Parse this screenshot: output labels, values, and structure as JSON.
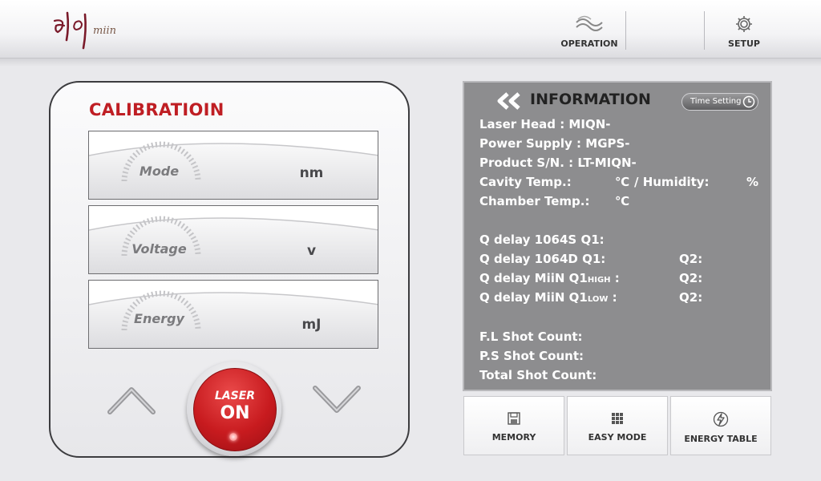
{
  "header": {
    "logo_text": "miin",
    "nav": [
      {
        "label": "OPERATION",
        "icon": "wave-icon"
      },
      {
        "label": "SETUP",
        "icon": "gear-icon"
      }
    ]
  },
  "calibration": {
    "title": "CALIBRATIOIN",
    "rows": [
      {
        "label": "Mode",
        "unit": "nm"
      },
      {
        "label": "Voltage",
        "unit": "v"
      },
      {
        "label": "Energy",
        "unit": "mJ"
      }
    ],
    "laser_button": {
      "line1": "LASER",
      "line2": "ON"
    }
  },
  "information": {
    "title": "INFORMATION",
    "time_setting_label": "Time Setting",
    "laser_head": "Laser Head : MIQN-",
    "power_supply": "Power Supply : MGPS-",
    "product_sn": "Product S/N. : LT-MIQN-",
    "cavity_temp": "Cavity Temp.:",
    "cavity_unit": "℃",
    "humidity": "/ Humidity:",
    "humidity_unit": "%",
    "chamber_temp": "Chamber Temp.:",
    "chamber_unit": "℃",
    "q_1064s": "Q delay 1064S  Q1:",
    "q_1064d": "Q delay 1064D Q1:",
    "q_1064d_q2": "Q2:",
    "q_miin_high_prefix": "Q delay MiiN Q1",
    "q_miin_high_sub": "HIGH",
    "q_miin_high_suffix": " :",
    "q_miin_high_q2": "Q2:",
    "q_miin_low_prefix": "Q delay MiiN Q1",
    "q_miin_low_sub": "LOW",
    "q_miin_low_suffix": "  :",
    "q_miin_low_q2": "Q2:",
    "fl_shot": "F.L  Shot Count:",
    "ps_shot": "P.S  Shot Count:",
    "total_shot": "Total Shot Count:"
  },
  "bottom_buttons": [
    {
      "label": "MEMORY",
      "icon": "floppy-icon"
    },
    {
      "label": "EASY MODE",
      "icon": "grid-icon"
    },
    {
      "label": "ENERGY TABLE",
      "icon": "lightning-icon"
    }
  ]
}
